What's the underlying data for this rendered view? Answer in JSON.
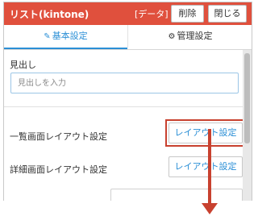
{
  "header": {
    "title": "リスト(kintone)",
    "data_tag": "[データ]",
    "delete_label": "削除",
    "close_label": "閉じる",
    "bg_color": "#e0503d"
  },
  "tabs": [
    {
      "label": "基本設定",
      "icon": "gear-icon",
      "active": true
    },
    {
      "label": "管理設定",
      "icon": "gear-icon",
      "active": false
    }
  ],
  "form": {
    "heading_label": "見出し",
    "heading_placeholder": "見出しを入力",
    "list_layout_label": "一覧画面レイアウト設定",
    "list_layout_button": "レイアウト設定",
    "detail_layout_label": "詳細画面レイアウト設定",
    "detail_layout_button": "レイアウト設定"
  },
  "annotation": {
    "highlight_color": "#c8412f",
    "arrow_direction": "down"
  },
  "accent_color": "#2b8fd6"
}
